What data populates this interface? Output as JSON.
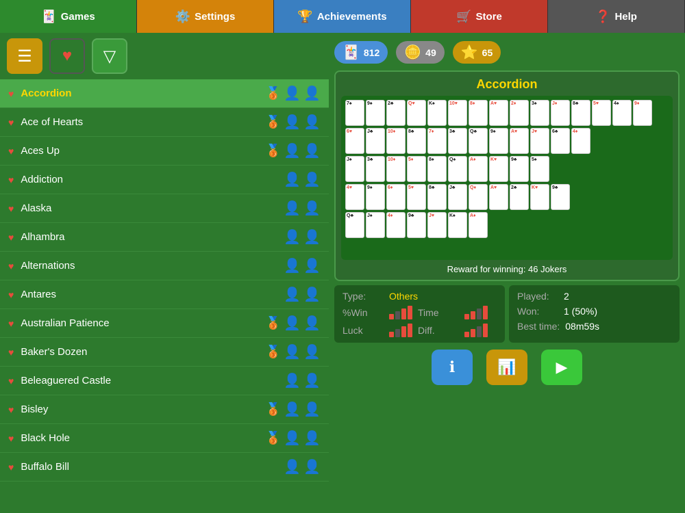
{
  "nav": {
    "items": [
      {
        "id": "games",
        "label": "Games",
        "icon": "🃏",
        "class": "games"
      },
      {
        "id": "settings",
        "label": "Settings",
        "icon": "⚙️",
        "class": "settings"
      },
      {
        "id": "achievements",
        "label": "Achievements",
        "icon": "🏆",
        "class": "achievements"
      },
      {
        "id": "store",
        "label": "Store",
        "icon": "🛒",
        "class": "store"
      },
      {
        "id": "help",
        "label": "Help",
        "icon": "❓",
        "class": "help"
      }
    ]
  },
  "stats": {
    "jokers": "812",
    "coins": "49",
    "stars": "65"
  },
  "toolbar": {
    "list_icon": "≡",
    "heart_icon": "♥",
    "filter_icon": "▽"
  },
  "games": [
    {
      "name": "Accordion",
      "active": true,
      "has_medal": true
    },
    {
      "name": "Ace of Hearts",
      "active": false,
      "has_medal": true
    },
    {
      "name": "Aces Up",
      "active": false,
      "has_medal": true
    },
    {
      "name": "Addiction",
      "active": false,
      "has_medal": false
    },
    {
      "name": "Alaska",
      "active": false,
      "has_medal": false
    },
    {
      "name": "Alhambra",
      "active": false,
      "has_medal": false
    },
    {
      "name": "Alternations",
      "active": false,
      "has_medal": false
    },
    {
      "name": "Antares",
      "active": false,
      "has_medal": false
    },
    {
      "name": "Australian Patience",
      "active": false,
      "has_medal": true
    },
    {
      "name": "Baker's Dozen",
      "active": false,
      "has_medal": true
    },
    {
      "name": "Beleaguered Castle",
      "active": false,
      "has_medal": false
    },
    {
      "name": "Bisley",
      "active": false,
      "has_medal": true
    },
    {
      "name": "Black Hole",
      "active": false,
      "has_medal": true
    },
    {
      "name": "Buffalo Bill",
      "active": false,
      "has_medal": false
    }
  ],
  "preview": {
    "title": "Accordion",
    "reward": "Reward for winning: 46 Jokers"
  },
  "game_stats": {
    "type_label": "Type:",
    "type_value": "Others",
    "win_label": "%Win",
    "time_label": "Time",
    "luck_label": "Luck",
    "diff_label": "Diff.",
    "played_label": "Played:",
    "played_value": "2",
    "won_label": "Won:",
    "won_value": "1 (50%)",
    "best_time_label": "Best time:",
    "best_time_value": "08m59s"
  },
  "buttons": {
    "info": "ℹ",
    "stats": "📊",
    "play": "▶"
  }
}
